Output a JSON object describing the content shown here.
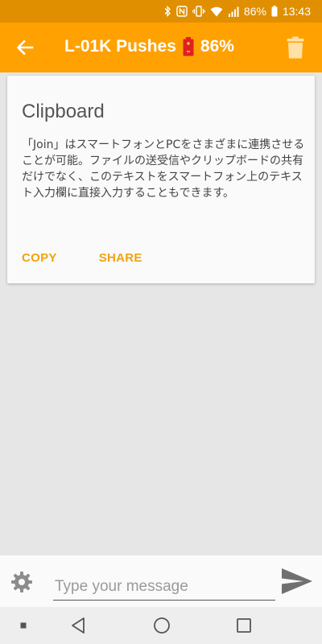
{
  "status_bar": {
    "battery": "86%",
    "time": "13:43",
    "icons": [
      "bluetooth-icon",
      "nfc-icon",
      "vibrate-icon",
      "wifi-icon",
      "signal-icon",
      "battery-icon"
    ]
  },
  "app_bar": {
    "title": "L-01K Pushes",
    "battery_level": "86%",
    "back_icon": "arrow-back-icon",
    "delete_icon": "trash-icon"
  },
  "card": {
    "title": "Clipboard",
    "body": "「Join」はスマートフォンとPCをさまざまに連携させることが可能。ファイルの送受信やクリップボードの共有だけでなく、このテキストをスマートフォン上のテキスト入力欄に直接入力することもできます。",
    "copy_label": "COPY",
    "share_label": "SHARE"
  },
  "composer": {
    "placeholder": "Type your message",
    "value": "",
    "settings_icon": "gear-icon",
    "send_icon": "send-icon"
  },
  "nav": {
    "items": [
      "recents-dot",
      "back-triangle",
      "home-circle",
      "overview-square"
    ]
  },
  "colors": {
    "status_bar": "#e08f00",
    "app_bar": "#ffa100",
    "accent": "#f2a20d",
    "battery_red": "#e02020"
  }
}
